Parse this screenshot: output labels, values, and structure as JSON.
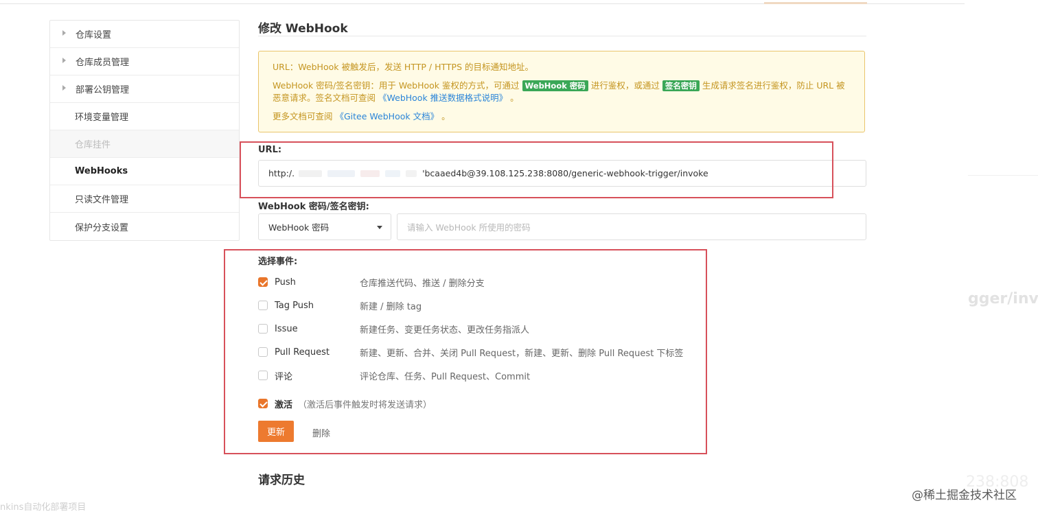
{
  "sidebar": {
    "items": [
      {
        "label": "仓库设置"
      },
      {
        "label": "仓库成员管理"
      },
      {
        "label": "部署公钥管理"
      },
      {
        "label": "环境变量管理"
      },
      {
        "label": "仓库挂件"
      },
      {
        "label": "WebHooks"
      },
      {
        "label": "只读文件管理"
      },
      {
        "label": "保护分支设置"
      }
    ]
  },
  "page": {
    "title": "修改 WebHook"
  },
  "notice": {
    "line1": "URL：WebHook 被触发后，发送 HTTP / HTTPS 的目标通知地址。",
    "line2_a": "WebHook 密码/签名密钥：用于 WebHook 鉴权的方式，可通过",
    "tag_password": "WebHook 密码",
    "line2_b": "进行鉴权，或通过",
    "tag_sign": "签名密钥",
    "line2_c": "生成请求签名进行鉴权，防止 URL 被恶意请求。签名文档可查阅",
    "line2_link": "《WebHook 推送数据格式说明》",
    "line2_end": "。",
    "line3_a": "更多文档可查阅",
    "line3_link": "《Gitee WebHook 文档》",
    "line3_end": "。"
  },
  "url": {
    "label": "URL:",
    "prefix": "http:/.",
    "suffix": "'bcaaed4b@39.108.125.238:8080/generic-webhook-trigger/invoke"
  },
  "auth": {
    "label": "WebHook 密码/签名密钥:",
    "select_value": "WebHook 密码",
    "password_placeholder": "请输入 WebHook 所使用的密码"
  },
  "events": {
    "title": "选择事件:",
    "items": [
      {
        "name": "Push",
        "desc": "仓库推送代码、推送 / 删除分支",
        "checked": true
      },
      {
        "name": "Tag Push",
        "desc": "新建 / 删除 tag",
        "checked": false
      },
      {
        "name": "Issue",
        "desc": "新建任务、变更任务状态、更改任务指派人",
        "checked": false
      },
      {
        "name": "Pull Request",
        "desc": "新建、更新、合并、关闭 Pull Request，新建、更新、删除 Pull Request 下标签",
        "checked": false
      },
      {
        "name": "评论",
        "desc": "评论仓库、任务、Pull Request、Commit",
        "checked": false
      }
    ]
  },
  "activate": {
    "label": "激活",
    "hint": "（激活后事件触发时将发送请求）",
    "checked": true
  },
  "actions": {
    "update": "更新",
    "delete": "删除"
  },
  "history": {
    "title": "请求历史"
  },
  "background_fragments": {
    "right_text": "gger/inv",
    "right_text2": "238:808",
    "bottom_left": "nkins自动化部署项目"
  },
  "watermark": "@稀土掘金技术社区",
  "colors": {
    "accent": "#ed7a2f",
    "notice_bg": "#fffbe6",
    "notice_border": "#e9c46a",
    "tag_green": "#3aa757",
    "highlight_red": "#d7505a"
  }
}
